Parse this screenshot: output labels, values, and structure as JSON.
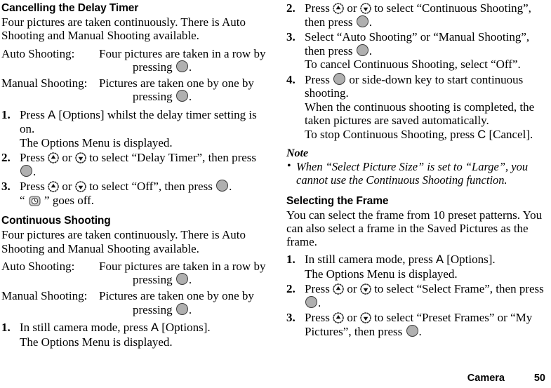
{
  "page": {
    "footer_label": "Camera",
    "footer_page_number": "50",
    "icons": {
      "center_key": "center-select-key-icon",
      "nav_up_key": "navigation-up-key-icon",
      "nav_down_key": "navigation-down-key-icon",
      "delay_timer": "delay-timer-icon",
      "softkey_a": "A",
      "softkey_c": "C"
    },
    "colors": {
      "text": "#000000",
      "background": "#ffffff",
      "key_fill": "#b0b0b0",
      "key_outline": "#3a3a3a"
    }
  },
  "left_column": {
    "section_1": {
      "heading": "Cancelling the Delay Timer",
      "intro": "Four pictures are taken continuously. There is Auto Shooting and Manual Shooting available.",
      "definitions": [
        {
          "term": "Auto Shooting:",
          "desc_line1": "Four pictures are taken in a row by",
          "desc_line2_before": "pressing",
          "desc_line2_after": "."
        },
        {
          "term": "Manual Shooting:",
          "desc_line1": "Pictures are taken one by one by",
          "desc_line2_before": "pressing",
          "desc_line2_after": "."
        }
      ],
      "steps": [
        {
          "num": "1.",
          "text_before": "Press",
          "softkey": "A",
          "text_after": "[Options] whilst the delay timer setting is on.",
          "sub": "The Options Menu is displayed."
        },
        {
          "num": "2.",
          "text_before": "Press",
          "text_mid": "or",
          "text_after": "to select “Delay Timer”, then press",
          "text_end": "."
        },
        {
          "num": "3.",
          "text_before": "Press",
          "text_mid": "or",
          "text_after": "to select “Off”, then press",
          "text_end": ".",
          "sub_quote_open": "“",
          "sub_quote_close": "” goes off."
        }
      ]
    },
    "section_2": {
      "heading": "Continuous Shooting",
      "intro": "Four pictures are taken continuously. There is Auto Shooting and Manual Shooting available.",
      "definitions": [
        {
          "term": "Auto Shooting:",
          "desc_line1": "Four pictures are taken in a row by",
          "desc_line2_before": "pressing",
          "desc_line2_after": "."
        },
        {
          "term": "Manual Shooting:",
          "desc_line1": "Pictures are taken one by one by",
          "desc_line2_before": "pressing",
          "desc_line2_after": "."
        }
      ],
      "steps": [
        {
          "num": "1.",
          "text_before": "In still camera mode, press",
          "softkey": "A",
          "text_after": "[Options].",
          "sub": "The Options Menu is displayed."
        }
      ]
    }
  },
  "right_column": {
    "continued_steps": [
      {
        "num": "2.",
        "text_before": "Press",
        "text_mid": "or",
        "text_after": "to select “Continuous Shooting”, then press",
        "text_end": "."
      },
      {
        "num": "3.",
        "text_before": "Select “Auto Shooting” or “Manual Shooting”, then press",
        "text_end": ".",
        "sub": "To cancel Continuous Shooting, select “Off”."
      },
      {
        "num": "4.",
        "text_before": "Press",
        "text_after": "or side-down key to start continuous shooting.",
        "sub_1": "When the continuous shooting is completed, the taken pictures are saved automatically.",
        "sub_2_before": "To stop Continuous Shooting, press",
        "sub_2_softkey": "C",
        "sub_2_after": "[Cancel]."
      }
    ],
    "note": {
      "heading": "Note",
      "items": [
        "When “Select Picture Size” is set to “Large”, you cannot use the Continuous Shooting function."
      ]
    },
    "section_3": {
      "heading": "Selecting the Frame",
      "intro": "You can select the frame from 10 preset patterns. You can also select a frame in the Saved Pictures as the frame.",
      "steps": [
        {
          "num": "1.",
          "text_before": "In still camera mode, press",
          "softkey": "A",
          "text_after": "[Options].",
          "sub": "The Options Menu is displayed."
        },
        {
          "num": "2.",
          "text_before": "Press",
          "text_mid": "or",
          "text_after": "to select “Select Frame”, then press",
          "text_end": "."
        },
        {
          "num": "3.",
          "text_before": "Press",
          "text_mid": "or",
          "text_after": "to select “Preset Frames” or “My Pictures”, then press",
          "text_end": "."
        }
      ]
    }
  }
}
